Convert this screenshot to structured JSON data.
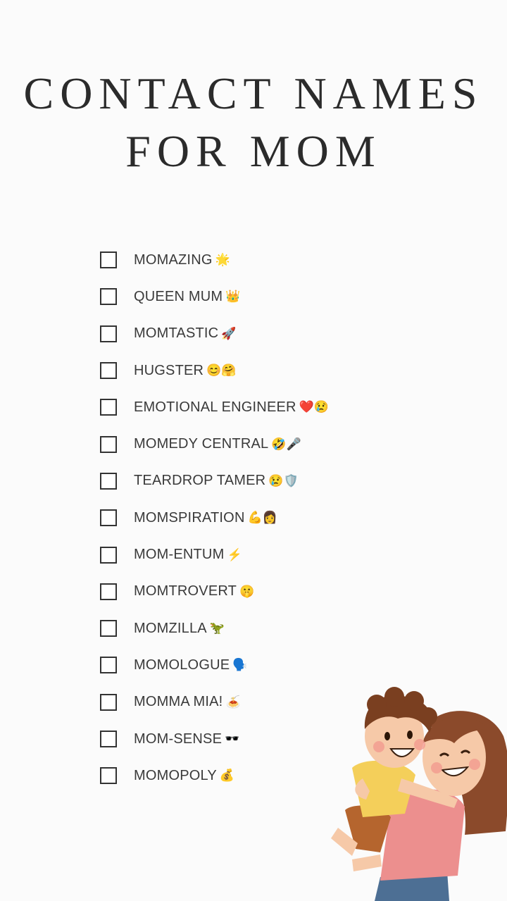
{
  "title": {
    "line1": "CONTACT NAMES",
    "line2": "FOR MOM"
  },
  "items": [
    {
      "label": "MOMAZING",
      "emoji": "🌟"
    },
    {
      "label": "QUEEN MUM",
      "emoji": "👑"
    },
    {
      "label": "MOMTASTIC",
      "emoji": "🚀"
    },
    {
      "label": "HUGSTER",
      "emoji": "😊🤗"
    },
    {
      "label": "EMOTIONAL ENGINEER",
      "emoji": "❤️😢"
    },
    {
      "label": "MOMEDY CENTRAL",
      "emoji": "🤣🎤"
    },
    {
      "label": "TEARDROP TAMER",
      "emoji": "😢🛡️"
    },
    {
      "label": "MOMSPIRATION",
      "emoji": "💪👩"
    },
    {
      "label": "MOM-ENTUM",
      "emoji": "⚡"
    },
    {
      "label": "MOMTROVERT",
      "emoji": "🤫"
    },
    {
      "label": "MOMZILLA",
      "emoji": "🦖"
    },
    {
      "label": "MOMOLOGUE",
      "emoji": "🗣️"
    },
    {
      "label": "MOMMA MIA!",
      "emoji": "🍝"
    },
    {
      "label": "MOM-SENSE",
      "emoji": "🕶️"
    },
    {
      "label": "MOMOPOLY",
      "emoji": "💰"
    }
  ],
  "illustration": {
    "icon": "mother-hugging-child-illustration"
  }
}
